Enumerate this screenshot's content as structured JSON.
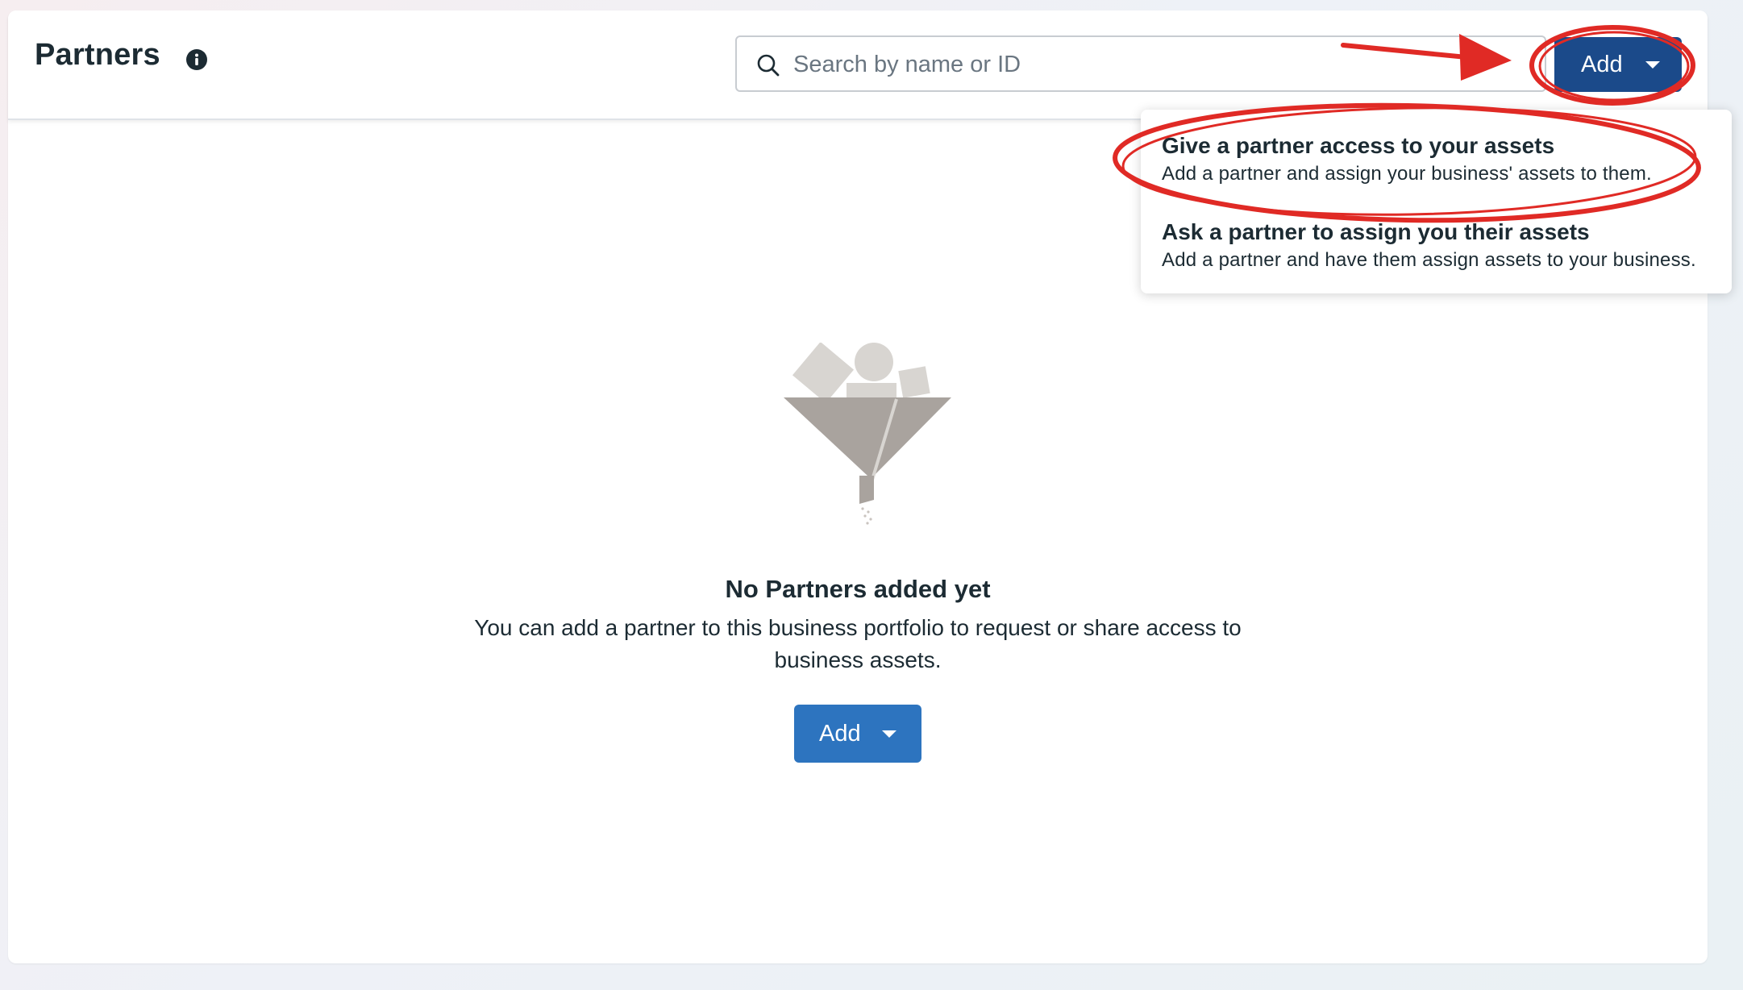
{
  "header": {
    "title": "Partners",
    "info_icon": "info-icon"
  },
  "search": {
    "placeholder": "Search by name or ID",
    "value": "",
    "icon": "search-icon"
  },
  "add_button": {
    "label": "Add",
    "icon": "caret-down-icon",
    "color": "#1b4a8a"
  },
  "dropdown": {
    "items": [
      {
        "title": "Give a partner access to your assets",
        "description": "Add a partner and assign your business' assets to them."
      },
      {
        "title": "Ask a partner to assign you their assets",
        "description": "Add a partner and have them assign assets to your business."
      }
    ]
  },
  "empty_state": {
    "illustration": "funnel-illustration",
    "title": "No Partners added yet",
    "description": "You can add a partner to this business portfolio to request or share access to business assets.",
    "button_label": "Add",
    "button_color": "#2d74bf"
  },
  "annotations": {
    "color": "#e02a25",
    "shapes": [
      "arrow",
      "circle-around-add-button",
      "ellipse-around-first-option"
    ]
  }
}
